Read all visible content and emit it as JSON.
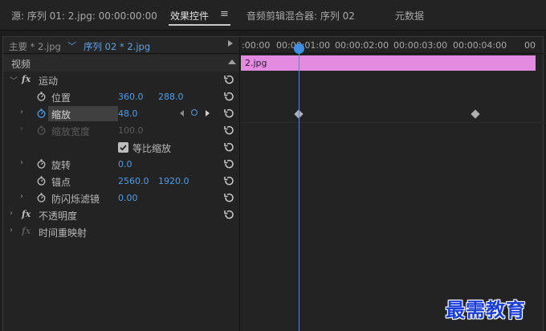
{
  "tabs": {
    "source": "源: 序列 01: 2.jpg: 00:00:00:00",
    "effect_controls": "效果控件",
    "audio_mixer": "音频剪辑混合器: 序列 02",
    "metadata": "元数据"
  },
  "clip_selector": {
    "master": "主要 * 2.jpg",
    "sequence": "序列 02 * 2.jpg"
  },
  "section_video": "视频",
  "effects": {
    "motion": "运动",
    "position": {
      "label": "位置",
      "x": "360.0",
      "y": "288.0"
    },
    "scale": {
      "label": "缩放",
      "value": "48.0"
    },
    "scale_width": {
      "label": "缩放宽度",
      "value": "100.0"
    },
    "uniform_scale": {
      "label": "等比缩放",
      "checked": true
    },
    "rotation": {
      "label": "旋转",
      "value": "0.0"
    },
    "anchor": {
      "label": "锚点",
      "x": "2560.0",
      "y": "1920.0"
    },
    "antiflicker": {
      "label": "防闪烁滤镜",
      "value": "0.00"
    },
    "opacity": "不透明度",
    "time_remap": "时间重映射"
  },
  "fx_glyph": "fx",
  "timeline": {
    "ticks": [
      ":00:00",
      "00:00:01:00",
      "00:00:02:00",
      "00:00:03:00",
      "00:00:04:00",
      "00"
    ],
    "clip_name": "2.jpg",
    "playhead_seconds": 1,
    "keyframes_seconds": [
      1,
      4
    ]
  },
  "watermark": "最需教育",
  "colors": {
    "accent_blue": "#3d8fe8",
    "clip_pink": "#e38be0",
    "panel_bg": "#232323"
  }
}
